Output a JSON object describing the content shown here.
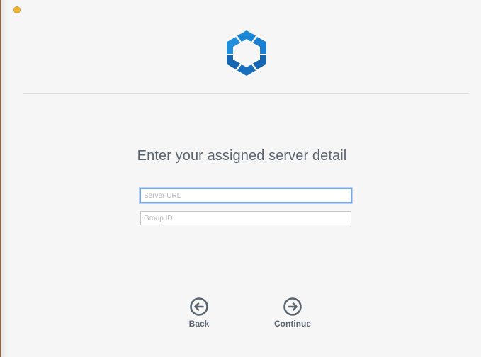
{
  "window": {
    "traffic_light_color": "#f5b731"
  },
  "brand": {
    "logo_icon": "hexagon-logo-icon",
    "colors": {
      "primary": "#1a7fd0",
      "dark": "#1565b0"
    }
  },
  "main": {
    "heading": "Enter your assigned server detail"
  },
  "form": {
    "server_url": {
      "value": "",
      "placeholder": "Server URL"
    },
    "group_id": {
      "value": "",
      "placeholder": "Group ID"
    }
  },
  "nav": {
    "back_label": "Back",
    "back_icon": "arrow-left-circle-icon",
    "continue_label": "Continue",
    "continue_icon": "arrow-right-circle-icon"
  }
}
